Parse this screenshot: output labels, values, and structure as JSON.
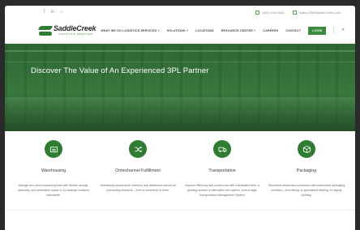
{
  "topbar": {
    "social": [
      "f",
      "in",
      "⌂"
    ],
    "phone": "(800) 918-4545",
    "email": "SalesCS@SaddleCreek.com"
  },
  "header": {
    "brand": "SaddleCreek",
    "brand_sub": "LOGISTICS SERVICES",
    "nav": [
      "WHAT WE DO LOGISTICS SERVICES ˅",
      "SOLUTIONS ˅",
      "LOCATIONS",
      "RESOURCE CENTER ˅",
      "CAREERS",
      "CONTACT"
    ],
    "login_label": "LOGIN",
    "search_icon": "⌕"
  },
  "hero": {
    "title": "Discover The Value of An Experienced 3PL Partner"
  },
  "services": [
    {
      "icon": "warehouse-icon",
      "title": "Warehousing",
      "text": "Manage and drive business growth with flexible storage, assembly, and distribution space in 44 strategic locations nationwide."
    },
    {
      "icon": "shuffle-icon",
      "title": "Omnichannel Fulfillment",
      "text": "Seamlessly synchronize inventory and distribution across all purchasing channels —from e-commerce to retail."
    },
    {
      "icon": "truck-icon",
      "title": "Transportation",
      "text": "Improve efficiency and control cost with a dedicated fleet, a growing number of alternative fuel options, and an agile Transportation Management System."
    },
    {
      "icon": "box-icon",
      "title": "Packaging",
      "text": "Streamline distribution processes with customized packaging solutions—from kitting, to specialized labeling, to display building."
    }
  ],
  "colors": {
    "brand_green": "#2f7d32",
    "login_green": "#3a8a3c"
  }
}
